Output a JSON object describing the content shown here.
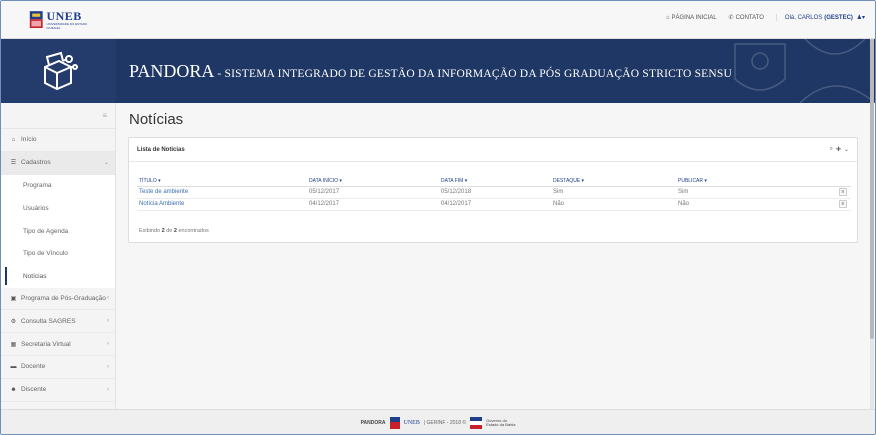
{
  "header": {
    "logo_text": "UNEB",
    "logo_subtext": "UNIVERSIDADE DO ESTADO DA BAHIA",
    "nav": {
      "home_label": "PÁGINA INICIAL",
      "contact_label": "CONTATO",
      "greeting": "Olá, CARLOS",
      "user_role": "(GESTEC)"
    }
  },
  "banner": {
    "title_main": "PANDORA",
    "title_rest": " - SISTEMA INTEGRADO DE GESTÃO DA INFORMAÇÃO DA PÓS GRADUAÇÃO STRICTO SENSU"
  },
  "sidebar": {
    "toggle_icon": "hamburger-icon",
    "items": [
      {
        "label": "Início",
        "icon": "home-icon"
      },
      {
        "label": "Cadastros",
        "icon": "list-icon",
        "expanded": true
      },
      {
        "label": "Programa de Pós-Graduação",
        "icon": "book-icon"
      },
      {
        "label": "Consulta SAGRES",
        "icon": "gear-icon"
      },
      {
        "label": "Secretaria Virtual",
        "icon": "bank-icon"
      },
      {
        "label": "Docente",
        "icon": "card-icon"
      },
      {
        "label": "Discente",
        "icon": "users-icon"
      }
    ],
    "subitems": [
      {
        "label": "Programa"
      },
      {
        "label": "Usuários"
      },
      {
        "label": "Tipo de Agenda"
      },
      {
        "label": "Tipo de Vínculo"
      },
      {
        "label": "Notícias",
        "active": true
      }
    ]
  },
  "main": {
    "page_title": "Notícias",
    "panel_title": "Lista de Notícias",
    "columns": [
      "TÍTULO ▾",
      "DATA INÍCIO ▾",
      "DATA FIM ▾",
      "DESTAQUE ▾",
      "PUBLICAR ▾"
    ],
    "rows": [
      [
        "Teste de ambiente",
        "05/12/2017",
        "05/12/2018",
        "Sim",
        "Sim"
      ],
      [
        "Notícia Ambiente",
        "04/12/2017",
        "04/12/2017",
        "Não",
        "Não"
      ]
    ],
    "count_prefix": "Exibindo ",
    "count_shown": "2",
    "count_mid": " de ",
    "count_total": "2",
    "count_suffix": " encontrados"
  },
  "footer": {
    "brand": "PANDORA",
    "uneb": "UNEB",
    "text": "| GERINF - 2018 ©",
    "gov_line1": "Governo do",
    "gov_line2": "Estado da Bahia"
  },
  "colors": {
    "banner": "#1f3764",
    "link": "#3a6fb0",
    "brand_blue": "#1f3f8a"
  }
}
